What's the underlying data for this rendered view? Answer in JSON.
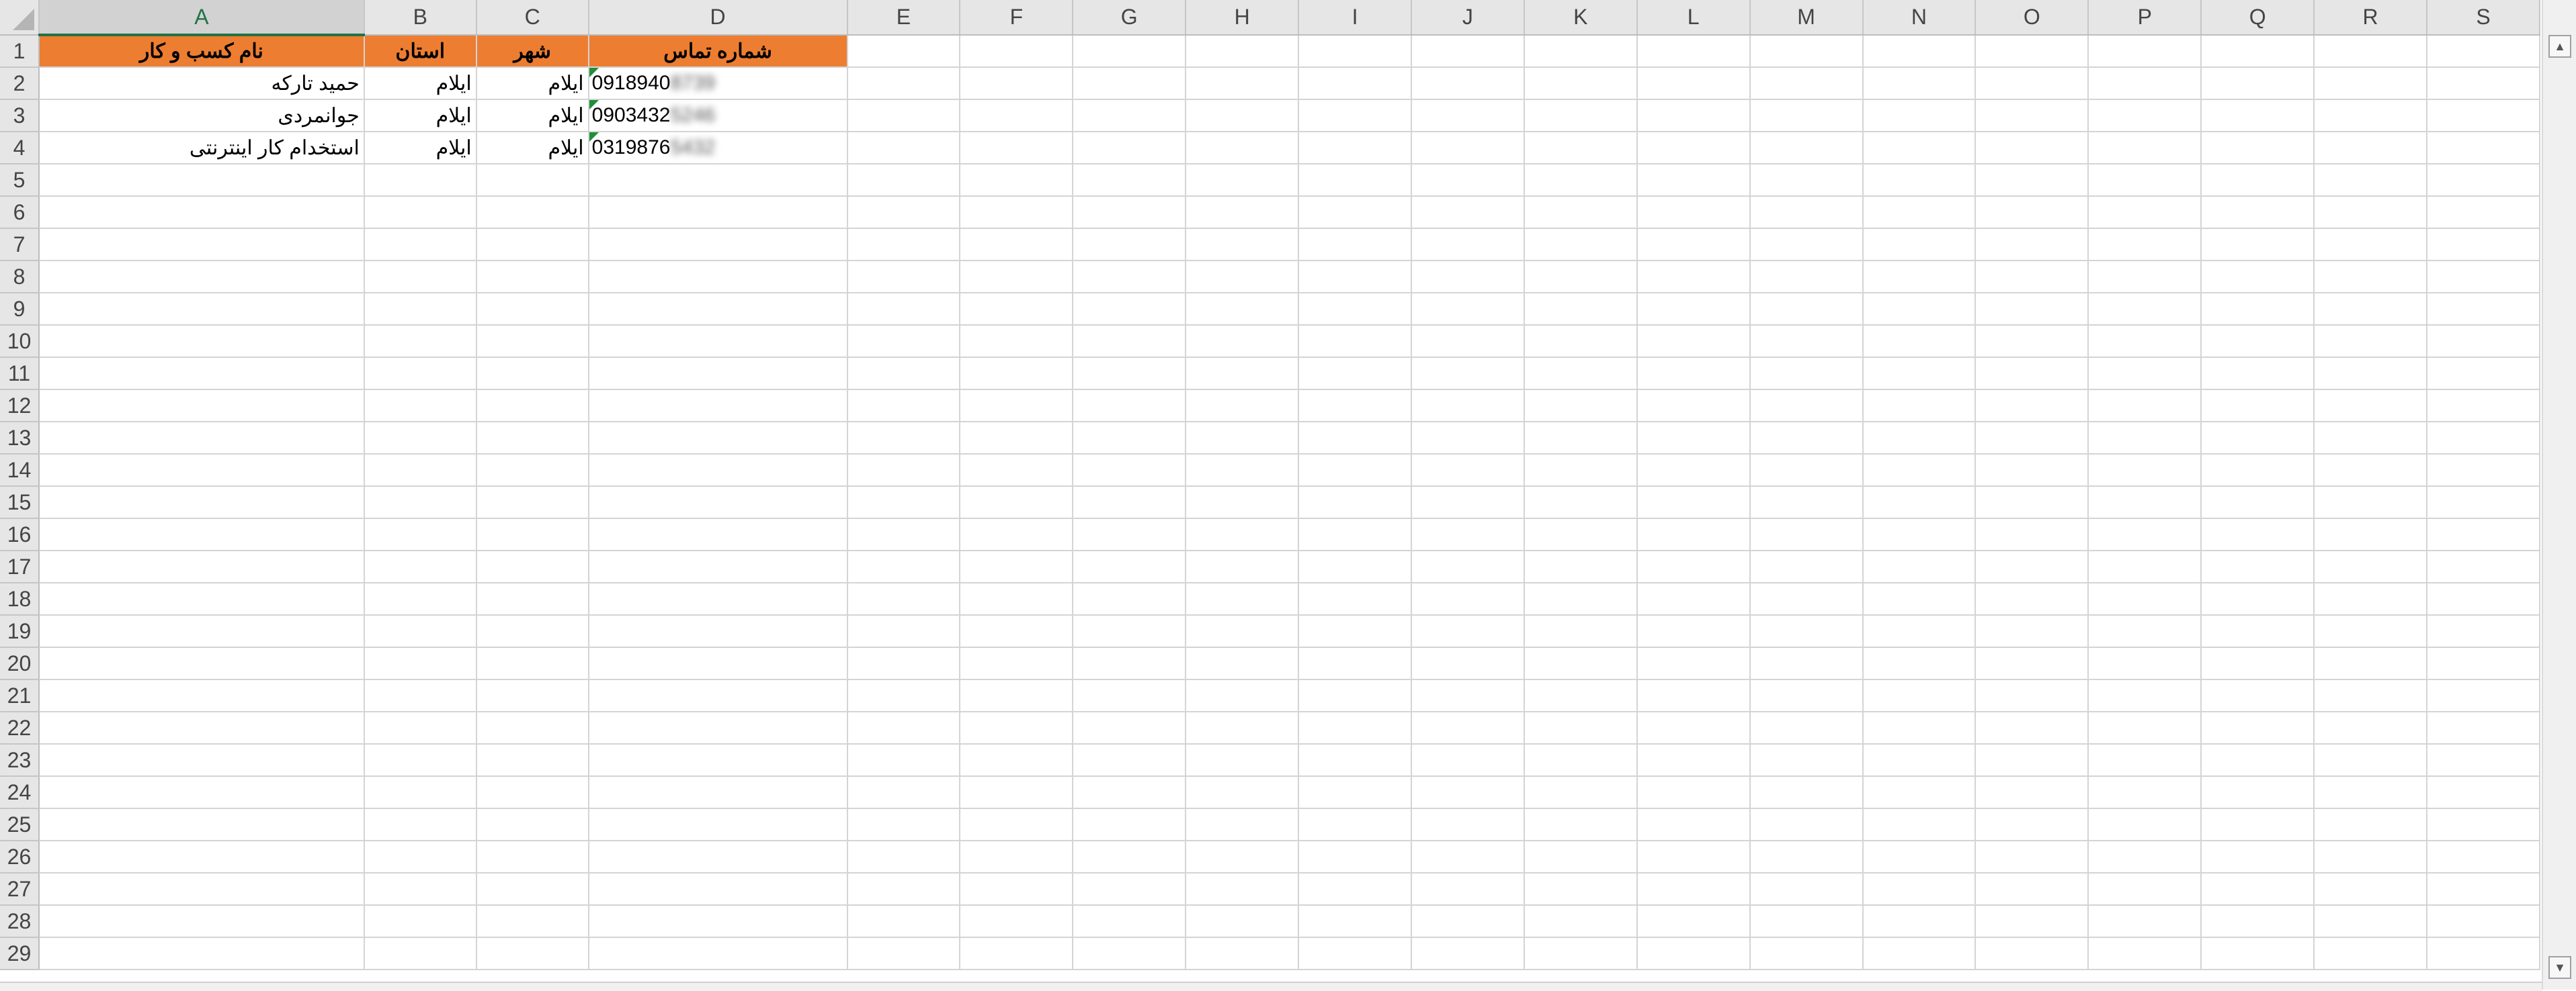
{
  "columns": [
    "A",
    "B",
    "C",
    "D",
    "E",
    "F",
    "G",
    "H",
    "I",
    "J",
    "K",
    "L",
    "M",
    "N",
    "O",
    "P",
    "Q",
    "R",
    "S"
  ],
  "rows": [
    "1",
    "2",
    "3",
    "4",
    "5",
    "6",
    "7",
    "8",
    "9",
    "10",
    "11",
    "12",
    "13",
    "14",
    "15",
    "16",
    "17",
    "18",
    "19",
    "20",
    "21",
    "22",
    "23",
    "24",
    "25",
    "26",
    "27",
    "28",
    "29"
  ],
  "header_row": {
    "a": "نام کسب و کار",
    "b": "استان",
    "c": "شهر",
    "d": "شماره تماس"
  },
  "data_rows": [
    {
      "a": "حمید تارکه",
      "b": "ایلام",
      "c": "ایلام",
      "d": "0918940",
      "d_blur": "8739"
    },
    {
      "a": "جوانمردی",
      "b": "ایلام",
      "c": "ایلام",
      "d": "0903432",
      "d_blur": "5246"
    },
    {
      "a": "استخدام کار اینترنتی",
      "b": "ایلام",
      "c": "ایلام",
      "d": "0319876",
      "d_blur": "5432"
    }
  ],
  "colors": {
    "header_fill": "#ed7d31",
    "header_text": "#ffffff",
    "selected_column": "#217346"
  },
  "icons": {
    "scroll_up": "▲",
    "scroll_down": "▼"
  }
}
